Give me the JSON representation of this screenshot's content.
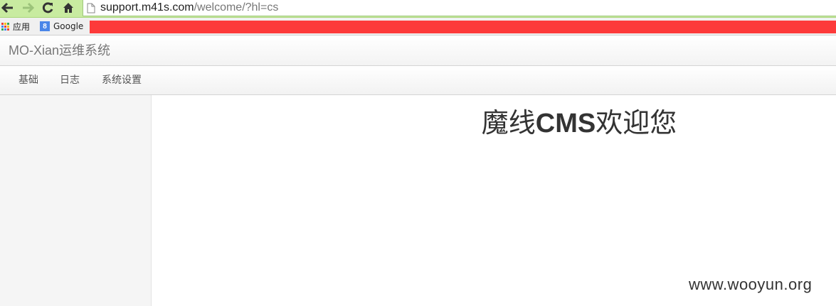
{
  "browser": {
    "url_host": "support.m41s.com",
    "url_path": "/welcome/?hl=cs",
    "bookmarks": [
      {
        "label": "应用",
        "icon": "apps-grid-icon"
      },
      {
        "label": "Google",
        "icon": "google-icon",
        "icon_letter": "8"
      }
    ],
    "colors": {
      "toolbar": "#c8eba0",
      "red_bar": "#fd3a3a"
    }
  },
  "app": {
    "brand": "MO-Xian运维系统",
    "nav": [
      "基础",
      "日志",
      "系统设置"
    ],
    "welcome": {
      "prefix": "魔线",
      "bold": "CMS",
      "suffix": "欢迎您"
    }
  },
  "watermark": "www.wooyun.org"
}
